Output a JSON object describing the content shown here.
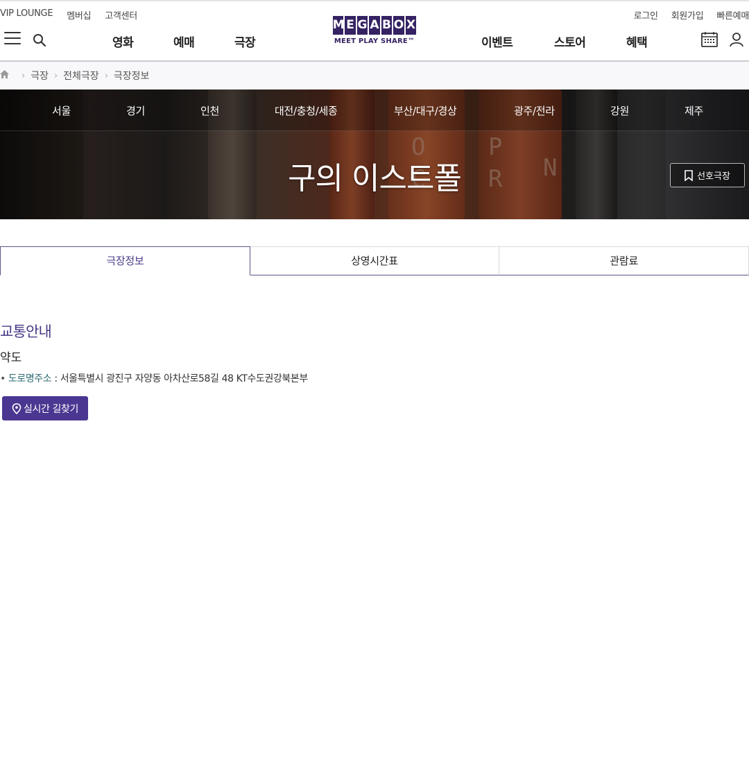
{
  "util_links_left": [
    "VIP LOUNGE",
    "멤버십",
    "고객센터"
  ],
  "util_links_right": [
    "로그인",
    "회원가입",
    "빠른예매"
  ],
  "nav_left": [
    "영화",
    "예매",
    "극장"
  ],
  "nav_right": [
    "이벤트",
    "스토어",
    "혜택"
  ],
  "logo": {
    "letters": [
      "M",
      "E",
      "G",
      "A",
      "B",
      "O",
      "X"
    ],
    "tagline": "MEET PLAY SHARE™",
    "brand_color": "#352263"
  },
  "breadcrumb": [
    "극장",
    "전체극장",
    "극장정보"
  ],
  "regions": [
    "서울",
    "경기",
    "인천",
    "대전/충청/세종",
    "부산/대구/경상",
    "광주/전라",
    "강원",
    "제주"
  ],
  "theater_name": "구의 이스트폴",
  "favorite_label": "선호극장",
  "tabs": [
    "극장정보",
    "상영시간표",
    "관람료"
  ],
  "active_tab": "극장정보",
  "content": {
    "section_title": "교통안내",
    "sub_title": "약도",
    "address_label": "도로명주소",
    "address_value": ": 서울특별시 광진구 자양동 아차산로58길 48 KT수도권강북본부",
    "route_button": "실시간 길찾기"
  }
}
